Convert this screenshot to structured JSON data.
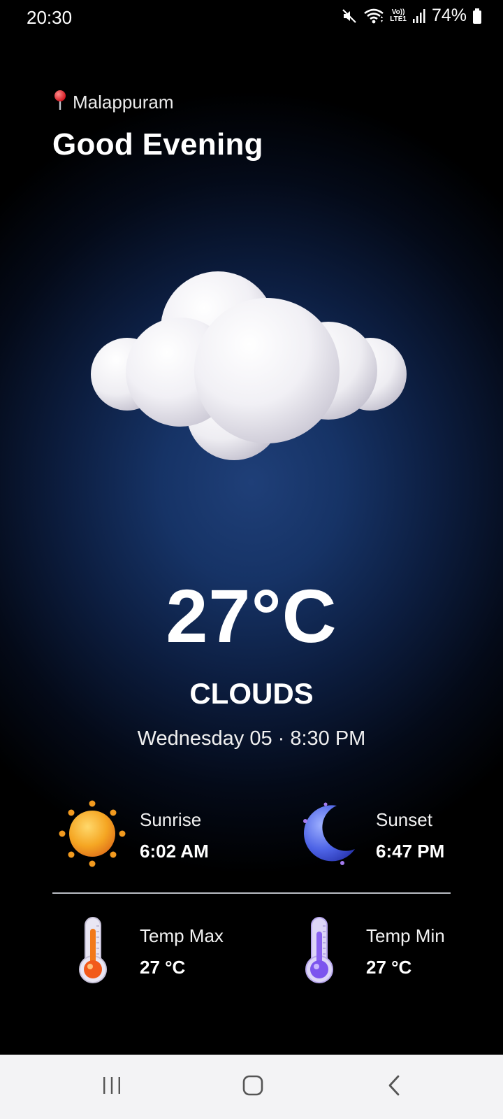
{
  "status_bar": {
    "time": "20:30",
    "lte_top": "Vo))",
    "lte_bottom": "LTE1",
    "battery_percent": "74%",
    "icons": [
      "mute-icon",
      "wifi-icon",
      "volte-icon",
      "signal-icon",
      "battery-icon"
    ]
  },
  "header": {
    "location_icon": "pin-icon",
    "location": "Malappuram",
    "greeting": "Good Evening"
  },
  "weather": {
    "icon": "cloud-icon",
    "temperature": "27°C",
    "condition": "CLOUDS",
    "datetime": "Wednesday 05 · 8:30 PM"
  },
  "details": {
    "sunrise": {
      "icon": "sun-icon",
      "label": "Sunrise",
      "value": "6:02 AM"
    },
    "sunset": {
      "icon": "moon-icon",
      "label": "Sunset",
      "value": "6:47 PM"
    },
    "temp_max": {
      "icon": "thermometer-hot-icon",
      "label": "Temp Max",
      "value": "27 °C"
    },
    "temp_min": {
      "icon": "thermometer-cold-icon",
      "label": "Temp Min",
      "value": "27 °C"
    }
  },
  "nav_bar": {
    "icons": [
      "recents-icon",
      "home-icon",
      "back-icon"
    ]
  },
  "colors": {
    "background_center": "#1f3f78",
    "background_edge": "#000000",
    "text": "#ffffff",
    "nav_bar": "#f3f3f5"
  }
}
